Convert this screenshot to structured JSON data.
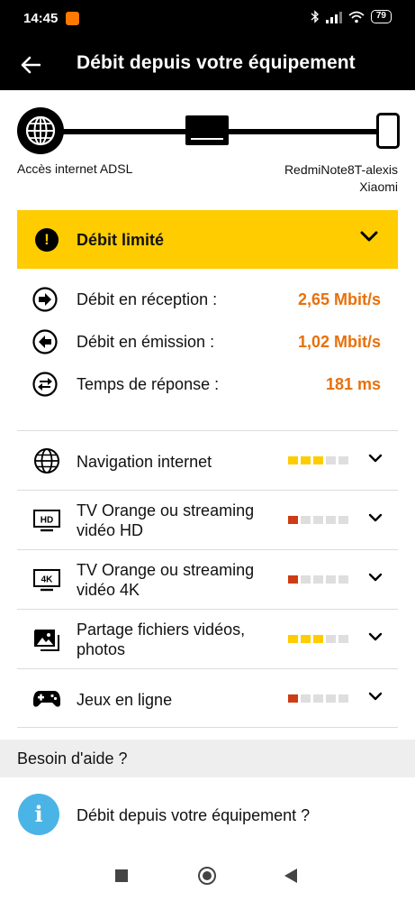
{
  "status_bar": {
    "time": "14:45",
    "battery": "79"
  },
  "app_bar": {
    "title": "Débit depuis votre équipement",
    "back_icon": "arrow-left-icon"
  },
  "connection": {
    "left_label": "Accès internet ADSL",
    "right_label_line1": "RedmiNote8T-alexis",
    "right_label_line2": "Xiaomi"
  },
  "alert": {
    "title": "Débit limité",
    "color": "#ffcc00"
  },
  "rates": [
    {
      "label": "Débit en réception :",
      "value": "2,65 Mbit/s",
      "icon": "arrow-right-circle-icon"
    },
    {
      "label": "Débit en émission :",
      "value": "1,02 Mbit/s",
      "icon": "arrow-left-circle-icon"
    },
    {
      "label": "Temps de réponse :",
      "value": "181 ms",
      "icon": "swap-arrows-circle-icon"
    }
  ],
  "usages": [
    {
      "label_line1": "Navigation internet",
      "label_line2": "",
      "icon": "globe-icon",
      "level": 3,
      "max": 5,
      "color": "#ffcc00",
      "hd_badge": ""
    },
    {
      "label_line1": "TV Orange ou streaming",
      "label_line2": "vidéo HD",
      "icon": "tv-hd-icon",
      "level": 1,
      "max": 5,
      "color": "#cd3c14",
      "hd_badge": "HD"
    },
    {
      "label_line1": "TV Orange ou streaming",
      "label_line2": "vidéo 4K",
      "icon": "tv-4k-icon",
      "level": 1,
      "max": 5,
      "color": "#cd3c14",
      "hd_badge": "4K"
    },
    {
      "label_line1": "Partage fichiers vidéos,",
      "label_line2": "photos",
      "icon": "image-icon",
      "level": 3,
      "max": 5,
      "color": "#ffcc00",
      "hd_badge": ""
    },
    {
      "label_line1": "Jeux en ligne",
      "label_line2": "",
      "icon": "gamepad-icon",
      "level": 1,
      "max": 5,
      "color": "#cd3c14",
      "hd_badge": ""
    }
  ],
  "help": {
    "header": "Besoin d'aide ?",
    "item": "Débit depuis votre équipement ?",
    "icon_glyph": "i"
  },
  "colors": {
    "accent_orange": "#e8700a",
    "info_blue": "#4bb4e6"
  }
}
